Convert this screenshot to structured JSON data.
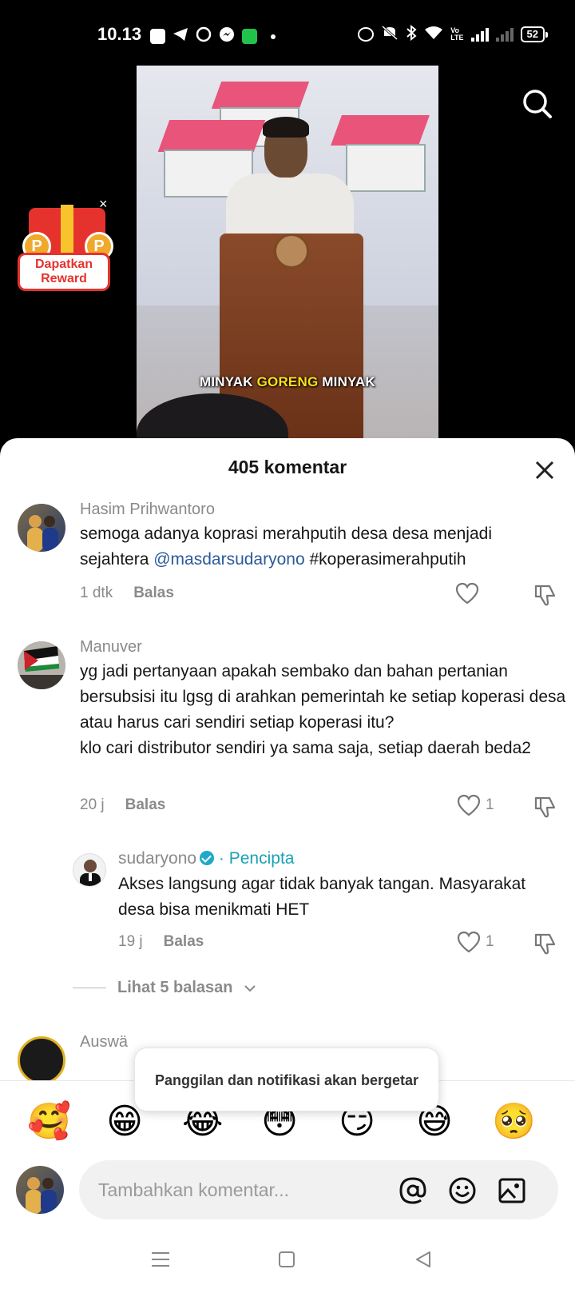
{
  "status_bar": {
    "time": "10.13",
    "battery": "52"
  },
  "video": {
    "caption_part1": "MINYAK ",
    "caption_highlight": "GORENG",
    "caption_part2": " MINYAK"
  },
  "reward": {
    "label_line1": "Dapatkan",
    "label_line2": "Reward"
  },
  "comments_sheet": {
    "title": "405 komentar",
    "comments": [
      {
        "user": "Hasim Prihwantoro",
        "text_before": "semoga adanya koprasi merahputih desa desa menjadi sejahtera ",
        "mention": "@masdarsudaryono",
        "text_after": " #koperasimerahputih",
        "time": "1 dtk",
        "reply": "Balas",
        "likes": ""
      },
      {
        "user": "Manuver",
        "text": "yg jadi pertanyaan apakah sembako dan bahan pertanian bersubsisi itu lgsg di arahkan pemerintah ke setiap koperasi desa atau harus cari sendiri setiap koperasi itu?\nklo cari distributor sendiri ya sama saja, setiap daerah beda2",
        "time": "20 j",
        "reply": "Balas",
        "likes": "1"
      },
      {
        "user": "sudaryono",
        "creator_badge": "· Pencipta",
        "text": "Akses langsung agar tidak banyak tangan. Masyarakat desa bisa menikmati HET",
        "time": "19 j",
        "reply": "Balas",
        "likes": "1"
      },
      {
        "user": "Auswä"
      }
    ],
    "more_replies": "Lihat 5 balasan"
  },
  "toast": "Panggilan dan notifikasi akan bergetar",
  "emojis": [
    "🥰",
    "😁",
    "😂",
    "😳",
    "😏",
    "😅",
    "🥺"
  ],
  "input": {
    "placeholder": "Tambahkan komentar..."
  }
}
